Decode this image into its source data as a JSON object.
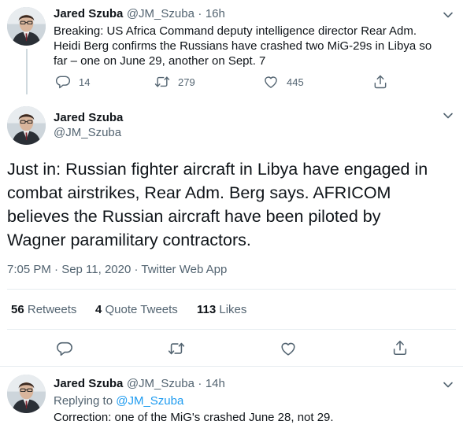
{
  "tweet1": {
    "author_name": "Jared Szuba",
    "author_handle": "@JM_Szuba",
    "separator": "·",
    "time": "16h",
    "text_lines": [
      "Breaking: US Africa Command deputy intelligence director Rear Adm.",
      "Heidi Berg confirms the Russians have crashed two MiG-29s in Libya so",
      "far – one on June 29, another on Sept. 7"
    ],
    "replies": "14",
    "retweets": "279",
    "likes": "445"
  },
  "main_tweet": {
    "author_name": "Jared Szuba",
    "author_handle": "@JM_Szuba",
    "text_lines": [
      "Just in: Russian fighter aircraft in Libya have engaged in",
      "combat airstrikes, Rear Adm. Berg says. AFRICOM",
      "believes the Russian aircraft have been piloted by",
      "Wagner paramilitary contractors."
    ],
    "timestamp": "7:05 PM · Sep 11, 2020 · Twitter Web App",
    "stats": {
      "retweets_count": "56",
      "retweets_label": "Retweets",
      "quote_count": "4",
      "quote_label": "Quote Tweets",
      "likes_count": "113",
      "likes_label": "Likes"
    }
  },
  "reply_tweet": {
    "author_name": "Jared Szuba",
    "author_handle": "@JM_Szuba",
    "separator": "·",
    "time": "14h",
    "replying_to_prefix": "Replying to",
    "replying_to_handle": "@JM_Szuba",
    "text": "Correction: one of the MiG's crashed June 28, not 29."
  },
  "icons": {
    "reply": "reply-icon",
    "retweet": "retweet-icon",
    "like": "heart-icon",
    "share": "share-icon",
    "more": "chevron-down-icon"
  },
  "colors": {
    "text": "#0f1419",
    "muted": "#536471",
    "link": "#1d9bf0",
    "divider": "#e6ecf0"
  }
}
